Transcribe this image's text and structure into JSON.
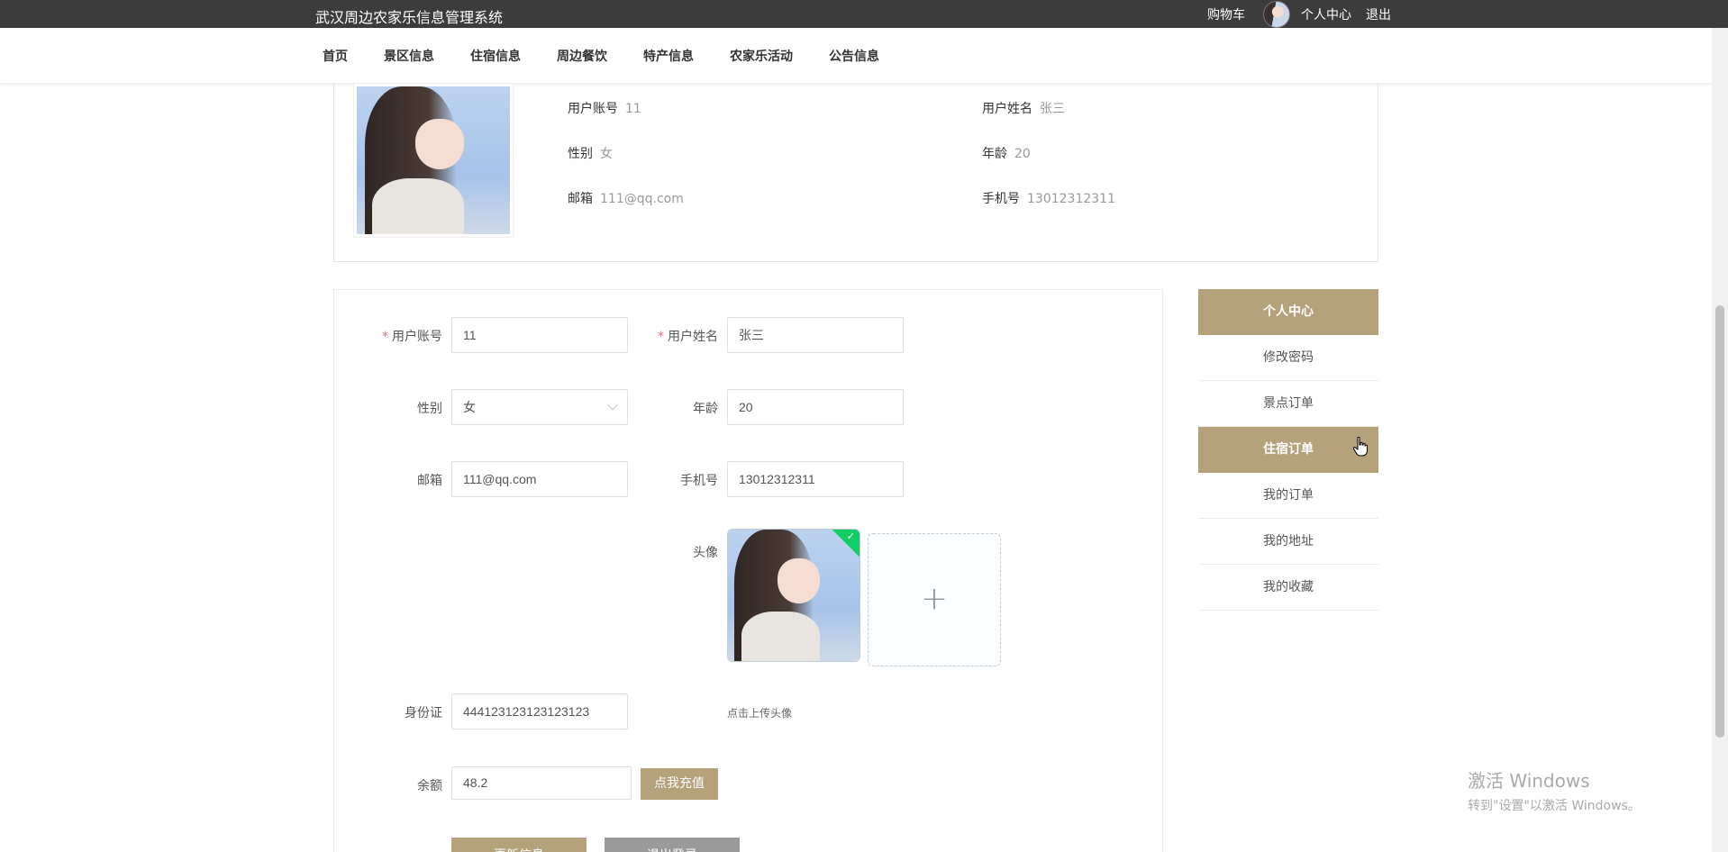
{
  "header": {
    "site_title": "武汉周边农家乐信息管理系统",
    "cart": "购物车",
    "user_center": "个人中心",
    "logout": "退出"
  },
  "nav": {
    "items": [
      "首页",
      "景区信息",
      "住宿信息",
      "周边餐饮",
      "特产信息",
      "农家乐活动",
      "公告信息"
    ]
  },
  "profile": {
    "account_label": "用户账号",
    "account_value": "11",
    "name_label": "用户姓名",
    "name_value": "张三",
    "gender_label": "性别",
    "gender_value": "女",
    "age_label": "年龄",
    "age_value": "20",
    "email_label": "邮箱",
    "email_value": "111@qq.com",
    "phone_label": "手机号",
    "phone_value": "13012312311"
  },
  "form": {
    "account_label": "用户账号",
    "account_value": "11",
    "name_label": "用户姓名",
    "name_value": "张三",
    "gender_label": "性别",
    "gender_value": "女",
    "age_label": "年龄",
    "age_value": "20",
    "email_label": "邮箱",
    "email_value": "111@qq.com",
    "phone_label": "手机号",
    "phone_value": "13012312311",
    "avatar_label": "头像",
    "upload_hint": "点击上传头像",
    "upload_plus": "+",
    "idcard_label": "身份证",
    "idcard_value": "444123123123123123",
    "balance_label": "余额",
    "balance_value": "48.2",
    "recharge_button": "点我充值",
    "update_button": "更新信息",
    "logout_button": "退出登录",
    "required_mark": "*"
  },
  "side_menu": {
    "items": [
      "个人中心",
      "修改密码",
      "景点订单",
      "住宿订单",
      "我的订单",
      "我的地址",
      "我的收藏"
    ]
  },
  "watermark": {
    "line1": "激活 Windows",
    "line2": "转到\"设置\"以激活 Windows。"
  },
  "colors": {
    "accent": "#b5a17a",
    "topbar": "#3c3c3c",
    "required": "#f56c6c",
    "success": "#13ce66"
  }
}
